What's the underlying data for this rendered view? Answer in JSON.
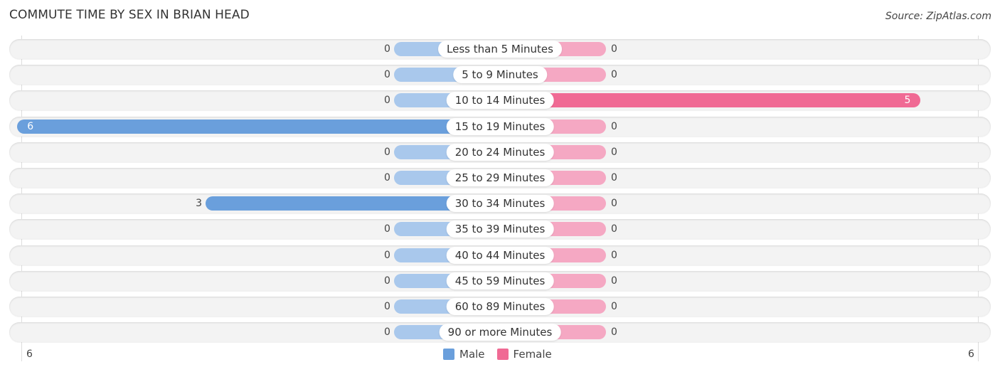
{
  "title": "COMMUTE TIME BY SEX IN BRIAN HEAD",
  "source": "Source: ZipAtlas.com",
  "colors": {
    "male": "#6a9fdc",
    "male_light": "#a9c8ec",
    "female": "#f06a94",
    "female_light": "#f5a8c3"
  },
  "chart_data": {
    "type": "bar",
    "orientation": "horizontal-diverging",
    "title": "COMMUTE TIME BY SEX IN BRIAN HEAD",
    "categories": [
      "Less than 5 Minutes",
      "5 to 9 Minutes",
      "10 to 14 Minutes",
      "15 to 19 Minutes",
      "20 to 24 Minutes",
      "25 to 29 Minutes",
      "30 to 34 Minutes",
      "35 to 39 Minutes",
      "40 to 44 Minutes",
      "45 to 59 Minutes",
      "60 to 89 Minutes",
      "90 or more Minutes"
    ],
    "series": [
      {
        "name": "Male",
        "values": [
          0,
          0,
          0,
          6,
          0,
          0,
          3,
          0,
          0,
          0,
          0,
          0
        ]
      },
      {
        "name": "Female",
        "values": [
          0,
          0,
          5,
          0,
          0,
          0,
          0,
          0,
          0,
          0,
          0,
          0
        ]
      }
    ],
    "axis_ticks": {
      "left": "6",
      "right": "6"
    },
    "xlim": [
      -6,
      6
    ],
    "legend": {
      "position": "bottom-center",
      "entries": [
        "Male",
        "Female"
      ]
    }
  }
}
